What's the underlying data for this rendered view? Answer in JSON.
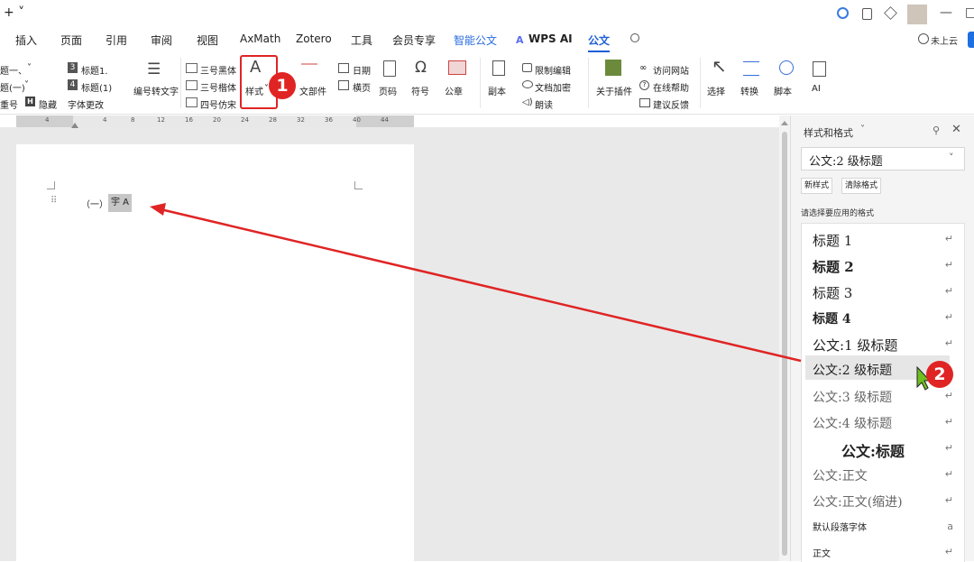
{
  "titlebar": {
    "new_tab": "+ ˅",
    "window_min": "—",
    "window_extra": "□"
  },
  "menu": {
    "items": [
      "插入",
      "页面",
      "引用",
      "审阅",
      "视图",
      "AxMath",
      "Zotero",
      "工具",
      "会员专享",
      "智能公文",
      "WPS AI",
      "公文"
    ],
    "upload": "未上云"
  },
  "ribbon": {
    "headings": [
      "题一、",
      "题(一)",
      "重号"
    ],
    "heading_arrows": [
      "˅",
      "˅"
    ],
    "hidden_mark": "H",
    "hidden_label": "隐藏",
    "title1_num": "3",
    "title1": "标题1.",
    "title2_num": "4",
    "title2": "标题(1)",
    "font_change": "字体更改",
    "number_convert": "编号转文字",
    "fonts": [
      "三号黑体",
      "三号楷体",
      "四号仿宋"
    ],
    "style_btn": "样式",
    "doc_part": "文部件",
    "date": "日期",
    "landscape": "横页",
    "page_number": "页码",
    "symbol": "符号",
    "seal": "公章",
    "copy": "副本",
    "restrict_edit": "限制编辑",
    "doc_encrypt": "文档加密",
    "read_aloud": "朗读",
    "about_plugin": "关于插件",
    "visit_site": "访问网站",
    "online_help": "在线帮助",
    "feedback": "建议反馈",
    "select": "选择",
    "convert": "转换",
    "script": "脚本",
    "ai": "AI"
  },
  "ruler": {
    "ticks": [
      "4",
      "4",
      "8",
      "12",
      "16",
      "20",
      "24",
      "28",
      "32",
      "36",
      "40",
      "44"
    ]
  },
  "document": {
    "line_prefix": "（一）",
    "line_text": "宇 A"
  },
  "panel": {
    "title": "样式和格式",
    "current_style": "公文:2 级标题",
    "new_style": "新样式",
    "clear_style": "清除格式",
    "choose_label": "请选择要应用的格式",
    "styles": [
      {
        "name": "标题 1",
        "weight": "normal"
      },
      {
        "name": "标题 2",
        "weight": "bold"
      },
      {
        "name": "标题 3",
        "weight": "normal"
      },
      {
        "name": "标题 4",
        "weight": "bold"
      },
      {
        "name": "公文:1 级标题",
        "weight": "normal"
      },
      {
        "name": "公文:2 级标题",
        "weight": "normal"
      },
      {
        "name": "公文:3 级标题",
        "weight": "normal"
      },
      {
        "name": "公文:4 级标题",
        "weight": "normal"
      },
      {
        "name": "公文:标题",
        "weight": "bold"
      },
      {
        "name": "公文:正文",
        "weight": "normal"
      },
      {
        "name": "公文:正文(缩进)",
        "weight": "normal"
      },
      {
        "name": "默认段落字体",
        "weight": "normal"
      },
      {
        "name": "正文",
        "weight": "normal"
      }
    ]
  },
  "annotations": {
    "badge1": "1",
    "badge2": "2"
  },
  "colors": {
    "accent_red": "#e02424",
    "tab_blue": "#1f5fd6"
  }
}
